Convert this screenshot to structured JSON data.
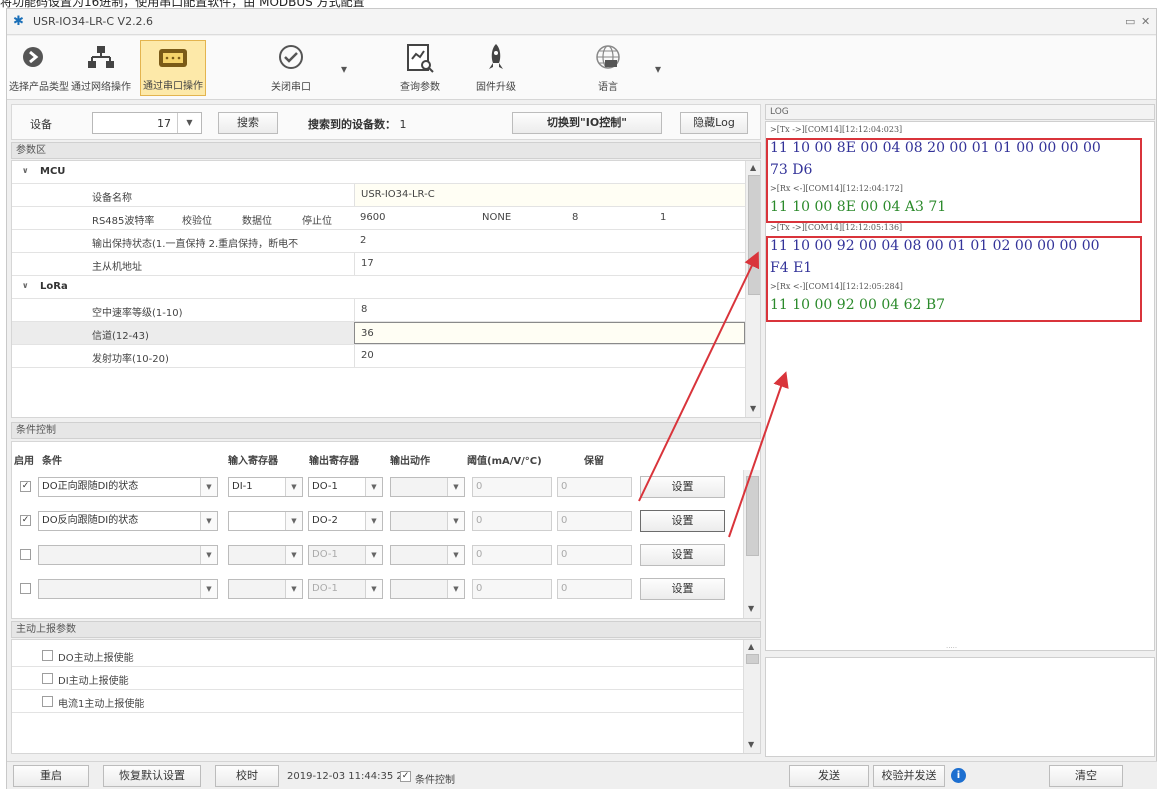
{
  "app": {
    "title": "USR-IO34-LR-C V2.2.6"
  },
  "toolbar": {
    "items": [
      {
        "label": "选择产品类型",
        "icon": "product-select-icon"
      },
      {
        "label": "通过网络操作",
        "icon": "network-icon"
      },
      {
        "label": "通过串口操作",
        "icon": "serial-port-icon",
        "active": true
      },
      {
        "label": "关闭串口",
        "icon": "check-circle-icon"
      },
      {
        "label": "查询参数",
        "icon": "query-params-icon"
      },
      {
        "label": "固件升级",
        "icon": "rocket-icon"
      },
      {
        "label": "语言",
        "icon": "globe-icon"
      }
    ]
  },
  "device": {
    "label": "设备",
    "value": "17",
    "search_label": "搜索",
    "found_label": "搜索到的设备数：",
    "found_count": "1",
    "switch_label": "切换到\"IO控制\"",
    "hide_log_label": "隐藏Log"
  },
  "params": {
    "section_title": "参数区",
    "mcu": {
      "group": "MCU",
      "device_name_label": "设备名称",
      "device_name_value": "USR-IO34-LR-C",
      "rs485_labels": [
        "RS485波特率",
        "校验位",
        "数据位",
        "停止位"
      ],
      "rs485_values": [
        "9600",
        "NONE",
        "8",
        "1"
      ],
      "output_hold_label": "输出保持状态(1.一直保持 2.重启保持，断电不",
      "output_hold_value": "2",
      "slave_addr_label": "主从机地址",
      "slave_addr_value": "17"
    },
    "lora": {
      "group": "LoRa",
      "air_rate_label": "空中速率等级(1-10)",
      "air_rate_value": "8",
      "channel_label": "信道(12-43)",
      "channel_value": "36",
      "tx_power_label": "发射功率(10-20)",
      "tx_power_value": "20"
    }
  },
  "conditions": {
    "section_title": "条件控制",
    "headers": [
      "启用",
      "条件",
      "输入寄存器",
      "输出寄存器",
      "输出动作",
      "阈值(mA/V/°C)",
      "保留"
    ],
    "rows": [
      {
        "enabled": "✓",
        "condition": "DO正向跟随DI的状态",
        "input": "DI-1",
        "output": "DO-1",
        "action": "",
        "threshold": "0",
        "reserved": "0",
        "button": "设置"
      },
      {
        "enabled": "✓",
        "condition": "DO反向跟随DI的状态",
        "input": "",
        "output": "DO-2",
        "action": "",
        "threshold": "0",
        "reserved": "0",
        "button": "设置"
      },
      {
        "enabled": "",
        "condition": "",
        "input": "",
        "output": "DO-1",
        "action": "",
        "threshold": "0",
        "reserved": "0",
        "button": "设置"
      },
      {
        "enabled": "",
        "condition": "",
        "input": "",
        "output": "DO-1",
        "action": "",
        "threshold": "0",
        "reserved": "0",
        "button": "设置"
      }
    ]
  },
  "report": {
    "section_title": "主动上报参数",
    "items": [
      "DO主动上报使能",
      "DI主动上报使能",
      "电流1主动上报使能"
    ]
  },
  "status": {
    "restart": "重启",
    "restore": "恢复默认设置",
    "sync_time": "校时",
    "datetime": "2019-12-03 11:44:35 2",
    "cond_ctrl_label": "条件控制",
    "cond_ctrl_checked": "✓"
  },
  "log": {
    "title": "LOG",
    "entries": [
      {
        "meta": ">[Tx ->][COM14][12:12:04:023]",
        "hex1": "11 10 00 8E 00 04 08 20 00 01 01 00 00 00 00",
        "hex2": "73 D6"
      },
      {
        "meta": ">[Rx <-][COM14][12:12:04:172]",
        "hex1": "11 10 00 8E 00 04 A3 71"
      },
      {
        "meta": ">[Tx ->][COM14][12:12:05:136]",
        "hex1": "11 10 00 92 00 04 08 00 01 01 02 00 00 00 00",
        "hex2": "F4 E1"
      },
      {
        "meta": ">[Rx <-][COM14][12:12:05:284]",
        "hex1": "11 10 00 92 00 04 62 B7"
      }
    ],
    "send": "发送",
    "checksum_send": "校验并发送",
    "clear": "清空"
  },
  "colors": {
    "accent_active": "#fde9a9",
    "tx_hex": "#333399",
    "rx_hex": "#2b8a2b",
    "highlight": "#d9343b"
  }
}
